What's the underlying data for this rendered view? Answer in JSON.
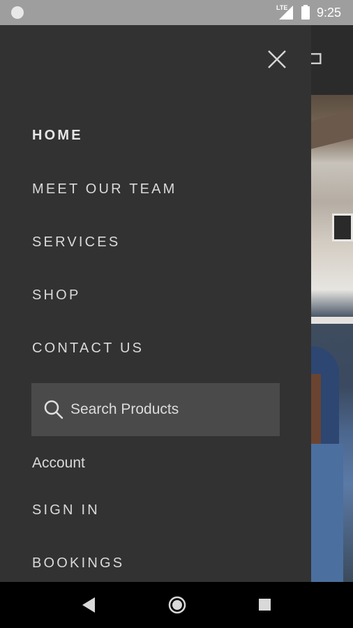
{
  "status_bar": {
    "network": "LTE",
    "time": "9:25"
  },
  "drawer": {
    "nav_items": [
      {
        "label": "HOME",
        "active": true
      },
      {
        "label": "MEET OUR TEAM",
        "active": false
      },
      {
        "label": "SERVICES",
        "active": false
      },
      {
        "label": "SHOP",
        "active": false
      },
      {
        "label": "CONTACT US",
        "active": false
      }
    ],
    "search": {
      "placeholder": "Search Products",
      "value": ""
    },
    "account_label": "Account",
    "secondary_items": [
      {
        "label": "SIGN IN"
      },
      {
        "label": "BOOKINGS"
      }
    ]
  },
  "icons": {
    "close": "close-icon",
    "search": "search-icon",
    "back": "back-icon",
    "home": "home-icon",
    "recents": "recents-icon"
  },
  "colors": {
    "drawer_bg": "#323232",
    "search_bg": "#4a4a4a",
    "text": "#d9d9d9",
    "status_bar_bg": "#9e9e9e"
  }
}
